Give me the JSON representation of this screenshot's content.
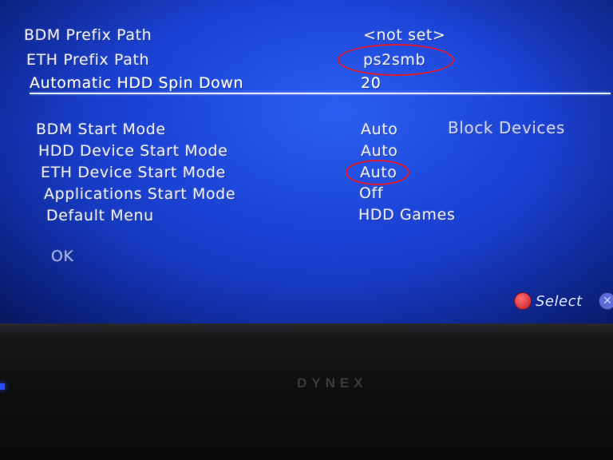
{
  "settings": {
    "bdm_prefix_path": {
      "label": "BDM Prefix Path",
      "value": "<not set>"
    },
    "eth_prefix_path": {
      "label": "ETH Prefix Path",
      "value": "ps2smb"
    },
    "automatic_hdd_spin_down": {
      "label": "Automatic HDD Spin Down",
      "value": "20"
    },
    "bdm_start_mode": {
      "label": "BDM Start Mode",
      "value": "Auto"
    },
    "hdd_device_start_mode": {
      "label": "HDD Device Start Mode",
      "value": "Auto"
    },
    "eth_device_start_mode": {
      "label": "ETH Device Start Mode",
      "value": "Auto"
    },
    "applications_start_mode": {
      "label": "Applications Start Mode",
      "value": "Off"
    },
    "default_menu": {
      "label": "Default Menu",
      "value": "HDD Games"
    }
  },
  "hint": "Block Devices",
  "ok_label": "OK",
  "footer": {
    "select_label": "Select"
  },
  "bezel": {
    "brand": "DYNEX"
  },
  "colors": {
    "background": "#1b43d6",
    "highlight_circle": "#e01b2e"
  },
  "icons": {
    "select_button": "circle-button-icon",
    "back_button": "cross-button-icon"
  }
}
